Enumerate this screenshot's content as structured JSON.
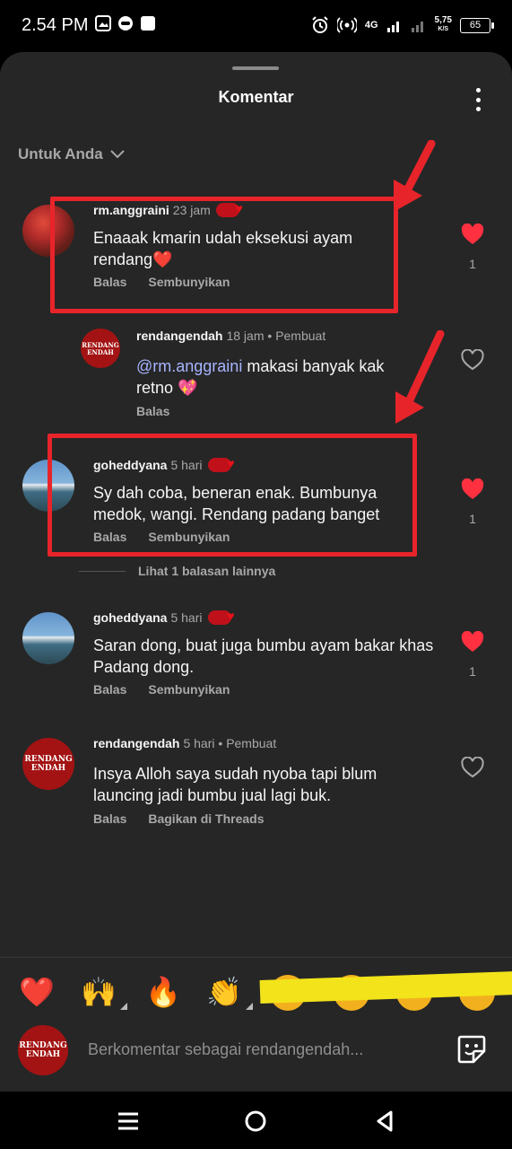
{
  "status_bar": {
    "time": "2.54 PM",
    "network": "4G",
    "speed": "5,75",
    "speed_unit": "K/S",
    "battery": "65"
  },
  "header": {
    "title": "Komentar",
    "more_icon": "more-vertical-icon"
  },
  "filter": {
    "label": "Untuk Anda"
  },
  "comments": [
    {
      "username": "rm.anggraini",
      "time": "23 jam",
      "text": "Enaaak kmarin udah eksekusi ayam rendang❤️",
      "actions": [
        "Balas",
        "Sembunyikan"
      ],
      "liked": true,
      "like_count": "1"
    },
    {
      "username": "rendangendah",
      "time": "18 jam",
      "role": "Pembuat",
      "mention": "@rm.anggraini",
      "text": " makasi banyak kak retno 💖",
      "actions": [
        "Balas"
      ],
      "liked": false,
      "avatar_text": [
        "RENDANG",
        "ENDAH"
      ]
    },
    {
      "username": "goheddyana",
      "time": "5 hari",
      "text": "Sy dah coba, beneran enak. Bumbunya medok, wangi.  Rendang padang banget",
      "actions": [
        "Balas",
        "Sembunyikan"
      ],
      "liked": true,
      "like_count": "1"
    },
    {
      "username": "goheddyana",
      "time": "5 hari",
      "text": "Saran dong, buat juga bumbu ayam bakar khas Padang dong.",
      "actions": [
        "Balas",
        "Sembunyikan"
      ],
      "liked": true,
      "like_count": "1"
    },
    {
      "username": "rendangendah",
      "time": "5 hari",
      "role": "Pembuat",
      "text": "Insya Alloh saya sudah nyoba tapi blum launcing jadi bumbu jual lagi buk.",
      "actions": [
        "Balas",
        "Bagikan di Threads"
      ],
      "liked": false,
      "avatar_text": [
        "RENDANG",
        "ENDAH"
      ]
    }
  ],
  "more_replies": "Lihat 1 balasan lainnya",
  "reactions": [
    "❤️",
    "🙌",
    "🔥",
    "👏"
  ],
  "composer": {
    "placeholder": "Berkomentar sebagai rendangendah...",
    "avatar_text": [
      "RENDANG",
      "ENDAH"
    ]
  },
  "colors": {
    "sheet_bg": "#262626",
    "like_red": "#ff3040",
    "annotation_red": "#e8242b",
    "annotation_yellow": "#f2e31a",
    "mention": "#a6b4ff"
  }
}
